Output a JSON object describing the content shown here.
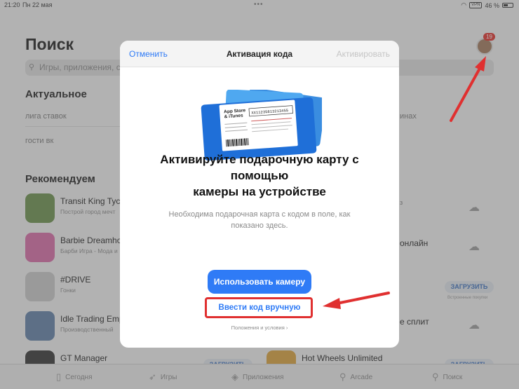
{
  "status_bar": {
    "time": "21:20",
    "date": "Пн 22 мая",
    "vpn": "VPN",
    "battery": "46 %"
  },
  "colors": {
    "accent": "#2f7bf6",
    "highlight": "#e03030",
    "badge": "#e0302a"
  },
  "page": {
    "title": "Поиск",
    "search_placeholder": "Игры, приложения, с",
    "avatar_badge": "19",
    "trending_title": "Актуальное",
    "trending": [
      "лига ставок",
      "гости вк"
    ],
    "trending_right": [
      "инах"
    ],
    "recommended_title": "Рекомендуем",
    "apps_left": [
      {
        "name": "Transit King Tycoo",
        "sub": "Построй город мечт",
        "icon_color": "#6a8f4a"
      },
      {
        "name": "Barbie Dreamhou",
        "sub": "Барби Игра - Мода и",
        "icon_color": "#d86aa6"
      },
      {
        "name": "#DRIVE",
        "sub": "Гонки",
        "icon_color": "#c03a3a"
      },
      {
        "name": "Idle Trading Emp",
        "sub": "Производственный",
        "icon_color": "#5f7fa6"
      },
      {
        "name": "GT Manager",
        "sub": "",
        "icon_color": "#333333"
      }
    ],
    "apps_right": [
      {
        "name": "онлайн",
        "sub": ""
      },
      {
        "name": "е сплит",
        "sub": ""
      },
      {
        "name": "Hot Wheels Unlimited",
        "sub": ""
      }
    ],
    "get_label": "ЗАГРУЗИТЬ",
    "inapp_label": "Встроенные покупки"
  },
  "tabs": [
    {
      "label": "Сегодня",
      "icon": "today-icon",
      "glyph": "▯"
    },
    {
      "label": "Игры",
      "icon": "rocket-icon",
      "glyph": "➶"
    },
    {
      "label": "Приложения",
      "icon": "layers-icon",
      "glyph": "◈"
    },
    {
      "label": "Arcade",
      "icon": "joystick-icon",
      "glyph": "⚲"
    },
    {
      "label": "Поиск",
      "icon": "search-icon",
      "glyph": "⚲"
    }
  ],
  "modal": {
    "cancel": "Отменить",
    "title": "Активация кода",
    "activate": "Активировать",
    "card_brand_line1": "App Store",
    "card_brand_line2": "& iTunes",
    "card_code": "XX11235813213455",
    "headline_line1": "Активируйте подарочную карту с",
    "headline_line2": "помощью",
    "headline_line3": "камеры на устройстве",
    "description": "Необходима подарочная карта с кодом в поле, как показано здесь.",
    "camera_button": "Использовать камеру",
    "manual_button": "Ввести код вручную",
    "terms": "Положения и условия ›"
  }
}
